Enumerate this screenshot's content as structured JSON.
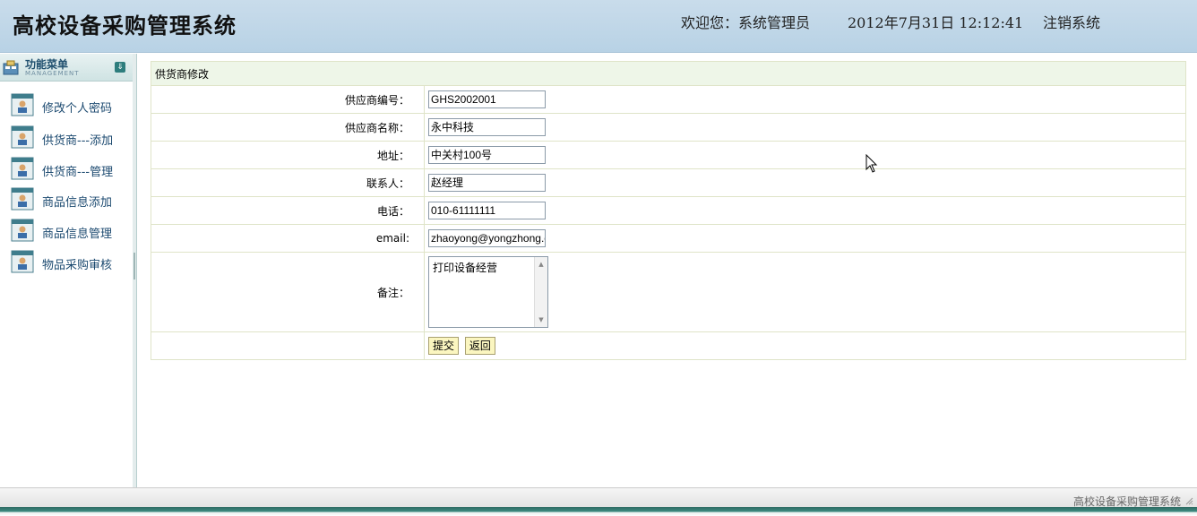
{
  "header": {
    "app_title": "高校设备采购管理系统",
    "welcome": "欢迎您：系统管理员",
    "datetime": "2012年7月31日  12:12:41",
    "logout": "注销系统"
  },
  "sidebar": {
    "menu_title": "功能菜单",
    "menu_subtitle": "MANAGEMENT",
    "toggle_icon": "double-chevron-down-icon",
    "items": [
      {
        "label": "修改个人密码",
        "icon": "user-doc-icon"
      },
      {
        "label": "供货商---添加",
        "icon": "user-doc-icon"
      },
      {
        "label": "供货商---管理",
        "icon": "user-doc-icon"
      },
      {
        "label": "商品信息添加",
        "icon": "user-doc-icon"
      },
      {
        "label": "商品信息管理",
        "icon": "user-doc-icon"
      },
      {
        "label": "物品采购审核",
        "icon": "user-doc-icon"
      }
    ]
  },
  "form": {
    "caption": "供货商修改",
    "fields": [
      {
        "label": "供应商编号：",
        "value": "GHS2002001"
      },
      {
        "label": "供应商名称：",
        "value": "永中科技"
      },
      {
        "label": "地址：",
        "value": "中关村100号"
      },
      {
        "label": "联系人：",
        "value": "赵经理"
      },
      {
        "label": "电话：",
        "value": "010-61111111"
      },
      {
        "label": "email:",
        "value": "zhaoyong@yongzhong.com"
      }
    ],
    "remarks_label": "备注：",
    "remarks_value": "打印设备经营",
    "submit_label": "提交",
    "back_label": "返回"
  },
  "footer": {
    "text": "高校设备采购管理系统"
  },
  "colors": {
    "header_bg": "#bcd4e6",
    "menu_text": "#1c4a70",
    "button_bg": "#fbf6c0",
    "form_caption_bg": "#eef6e8"
  }
}
